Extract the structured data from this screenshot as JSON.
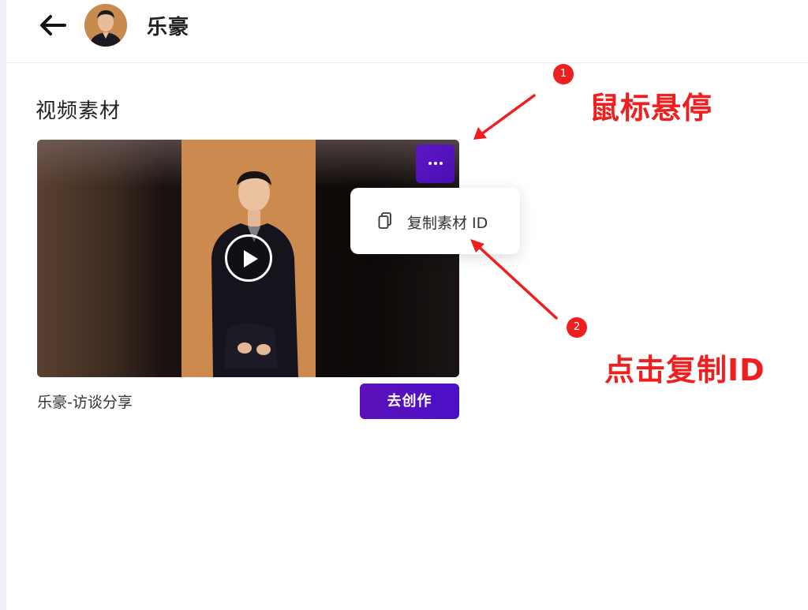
{
  "header": {
    "title": "乐豪",
    "back_icon": "arrow-left-icon",
    "avatar_icon": "avatar-icon"
  },
  "section": {
    "title": "视频素材"
  },
  "video": {
    "name": "乐豪-访谈分享",
    "more_icon": "more-horizontal-icon",
    "play_icon": "play-icon",
    "create_button": "去创作"
  },
  "menu": {
    "copy_label": "复制素材 ID",
    "copy_icon": "copy-icon"
  },
  "annotations": {
    "step1_number": "1",
    "step1_text": "鼠标悬停",
    "step2_number": "2",
    "step2_text": "点击复制ID",
    "color": "#f01f1f"
  },
  "colors": {
    "accent": "#5d10b8",
    "annotation_red": "#f01f1f"
  }
}
